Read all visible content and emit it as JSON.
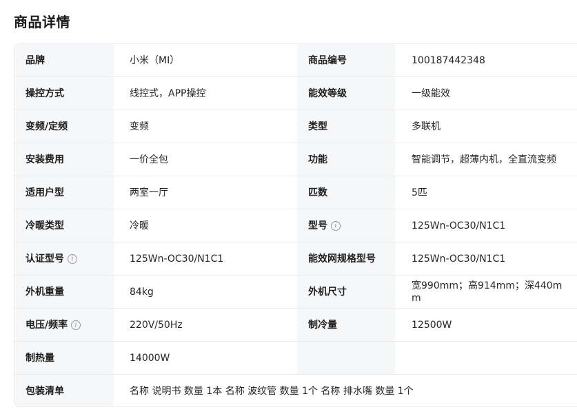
{
  "page": {
    "title": "商品详情"
  },
  "specs": {
    "row1": {
      "l1": "品牌",
      "v1": "小米（MI）",
      "l2": "商品编号",
      "v2": "100187442348"
    },
    "row2": {
      "l1": "操控方式",
      "v1": "线控式，APP操控",
      "l2": "能效等级",
      "v2": "一级能效"
    },
    "row3": {
      "l1": "变频/定频",
      "v1": "变频",
      "l2": "类型",
      "v2": "多联机"
    },
    "row4": {
      "l1": "安装费用",
      "v1": "一价全包",
      "l2": "功能",
      "v2": "智能调节，超薄内机，全直流变频"
    },
    "row5": {
      "l1": "适用户型",
      "v1": "两室一厅",
      "l2": "匹数",
      "v2": "5匹"
    },
    "row6": {
      "l1": "冷暖类型",
      "v1": "冷暖",
      "l2": "型号",
      "v2": "125Wn-OC30/N1C1"
    },
    "row7": {
      "l1": "认证型号",
      "v1": "125Wn-OC30/N1C1",
      "l2": "能效网规格型号",
      "v2": "125Wn-OC30/N1C1"
    },
    "row8": {
      "l1": "外机重量",
      "v1": "84kg",
      "l2": "外机尺寸",
      "v2": "宽990mm；高914mm；深440mm"
    },
    "row9": {
      "l1": "电压/频率",
      "v1": "220V/50Hz",
      "l2": "制冷量",
      "v2": "12500W"
    },
    "row10": {
      "l1": "制热量",
      "v1": "14000W"
    },
    "row11": {
      "l1": "包装清单",
      "v1": "名称 说明书 数量 1本 名称 波纹管 数量 1个 名称 排水嘴 数量 1个"
    }
  },
  "icons": {
    "info": "info-icon"
  }
}
